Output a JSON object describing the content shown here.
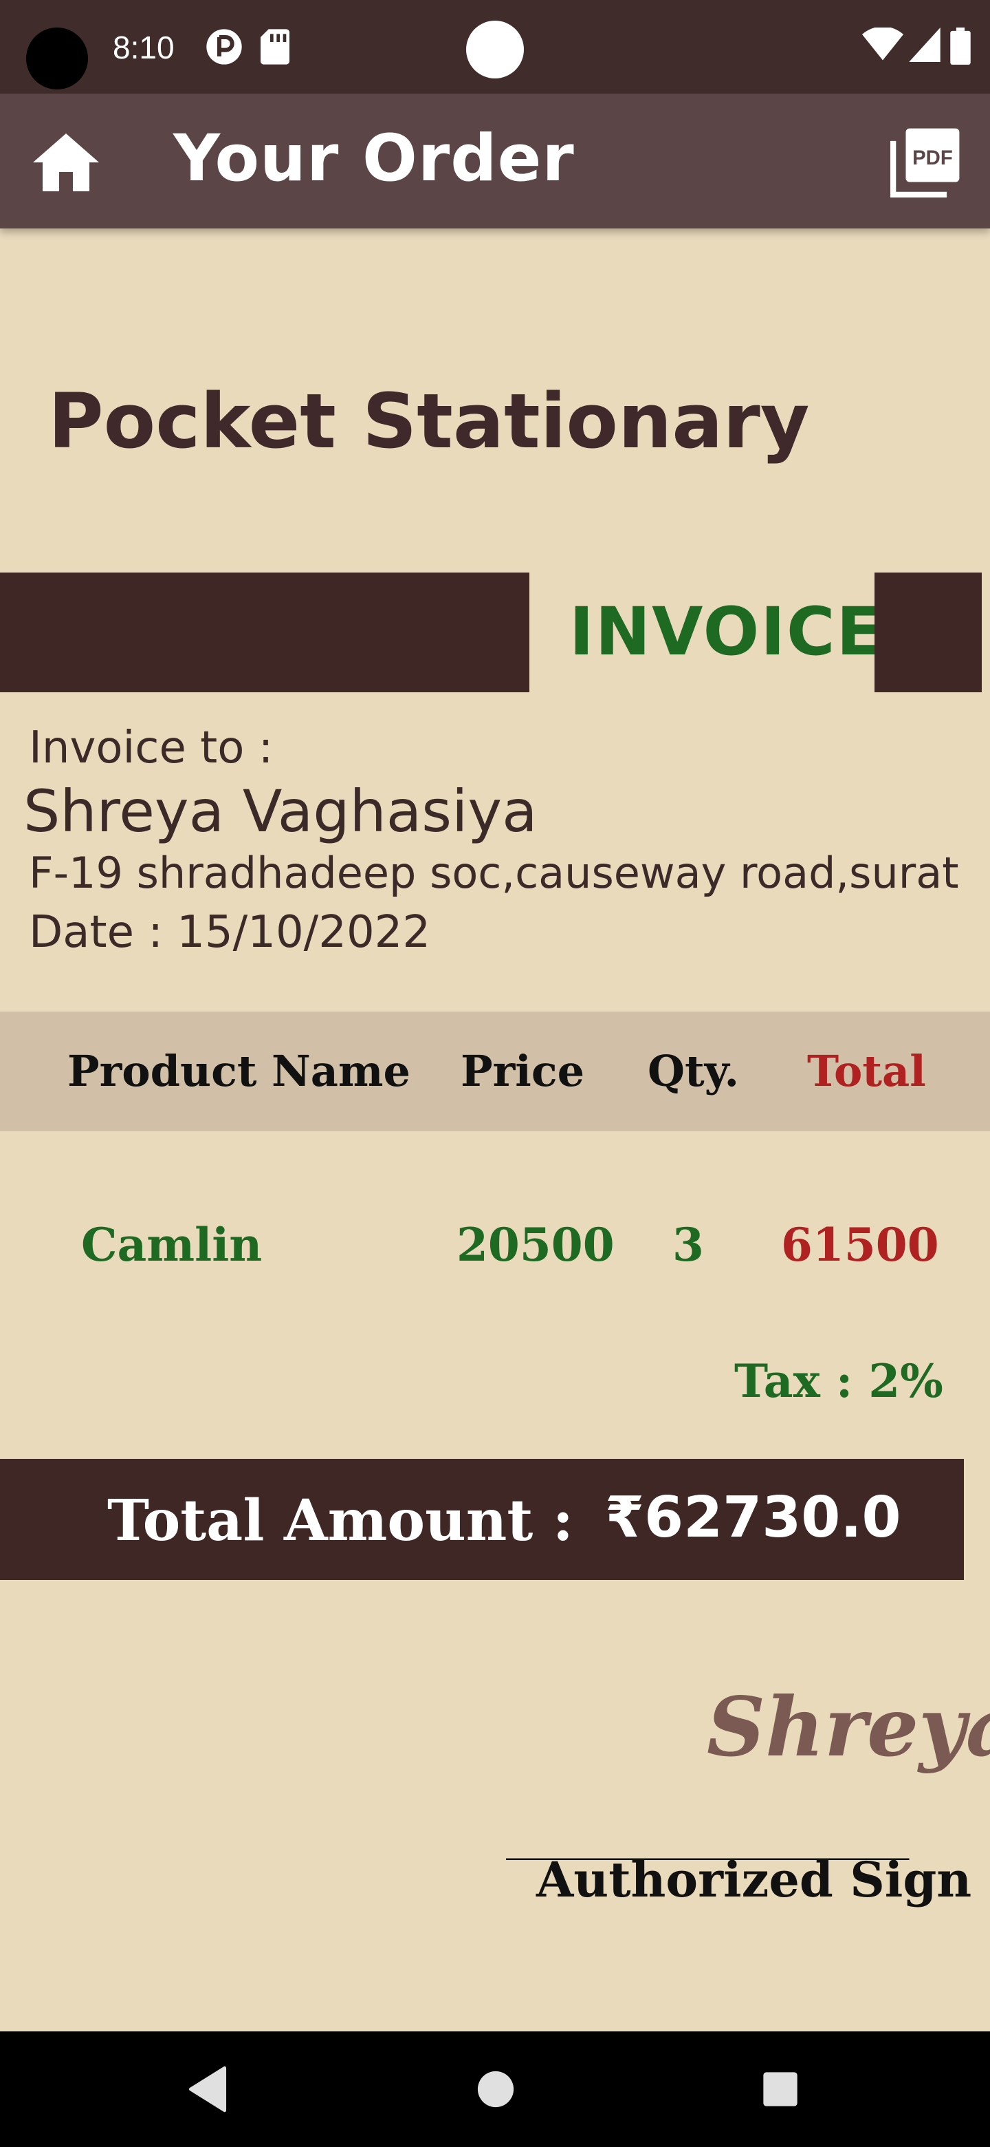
{
  "status_bar": {
    "time": "8:10"
  },
  "app_bar": {
    "title": "Your Order",
    "pdf_label": "PDF"
  },
  "store": {
    "name": "Pocket Stationary"
  },
  "invoice": {
    "label": "INVOICE",
    "invoice_to_label": "Invoice to :",
    "customer_name": "Shreya Vaghasiya",
    "address": "F-19 shradhadeep soc,causeway road,surat",
    "date": "Date : 15/10/2022"
  },
  "table": {
    "headers": [
      "Product Name",
      "Price",
      "Qty.",
      "Total"
    ],
    "rows": [
      {
        "product": "Camlin",
        "price": "20500",
        "qty": "3",
        "total": "61500"
      }
    ],
    "tax": "Tax : 2%"
  },
  "total": {
    "label": "Total Amount  :",
    "value": "₹62730.0"
  },
  "signature": {
    "name": "Shreya",
    "line": "________________",
    "label": "Authorized Sign"
  },
  "colors": {
    "background": "#e9dabc",
    "dark_brown": "#3e2725",
    "app_bar": "#5b4546",
    "green": "#1f6a23",
    "red": "#b02121",
    "table_header": "#d1c0a7"
  },
  "icons": {
    "home": "home-icon",
    "pdf": "pdf-icon",
    "back": "back-triangle-icon",
    "home_nav": "home-circle-icon",
    "recents": "recents-square-icon"
  }
}
